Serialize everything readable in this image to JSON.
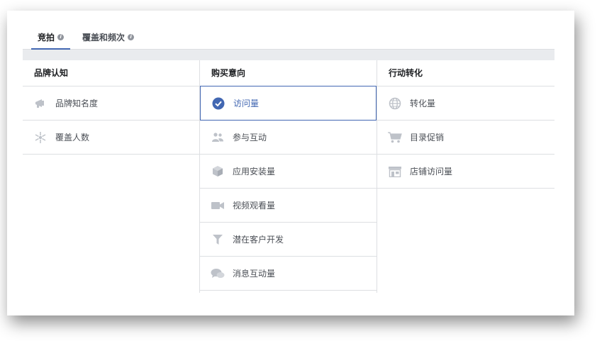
{
  "tabs": [
    {
      "label": "竞拍",
      "active": true,
      "icon": "info-icon"
    },
    {
      "label": "覆盖和频次",
      "active": false,
      "icon": "info-icon"
    }
  ],
  "info_glyph": "i",
  "columns": [
    {
      "header": "品牌认知",
      "items": [
        {
          "label": "品牌知名度",
          "icon": "megaphone-icon"
        },
        {
          "label": "覆盖人数",
          "icon": "reach-icon"
        }
      ]
    },
    {
      "header": "购买意向",
      "items": [
        {
          "label": "访问量",
          "icon": "check-circle-icon",
          "selected": true
        },
        {
          "label": "参与互动",
          "icon": "people-icon"
        },
        {
          "label": "应用安装量",
          "icon": "box-icon"
        },
        {
          "label": "视频观看量",
          "icon": "video-camera-icon"
        },
        {
          "label": "潜在客户开发",
          "icon": "funnel-icon"
        },
        {
          "label": "消息互动量",
          "icon": "chat-bubbles-icon"
        }
      ]
    },
    {
      "header": "行动转化",
      "items": [
        {
          "label": "转化量",
          "icon": "globe-icon"
        },
        {
          "label": "目录促销",
          "icon": "shopping-cart-icon"
        },
        {
          "label": "店铺访问量",
          "icon": "store-icon"
        }
      ]
    }
  ],
  "colors": {
    "accent": "#4267b2",
    "icon_gray": "#bec2c9",
    "border": "#dddfe2",
    "strip": "#e9ebee"
  }
}
